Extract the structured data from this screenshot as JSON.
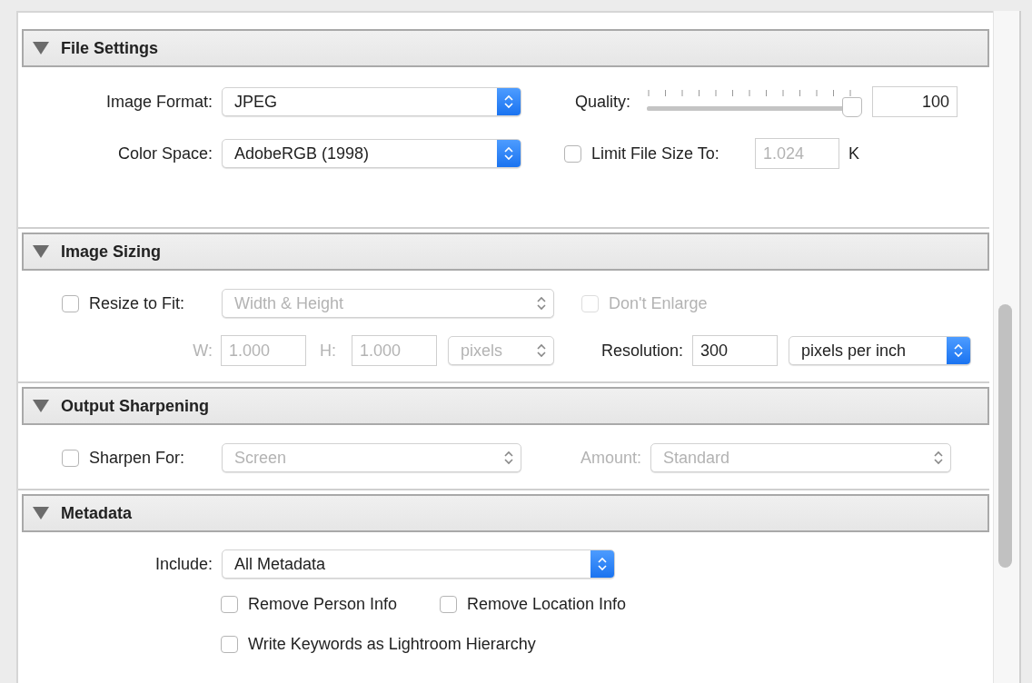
{
  "sections": [
    {
      "title": "File Settings",
      "expanded": true,
      "rows": [
        {
          "controls": [
            {
              "kind": "label",
              "text": "Image Format:",
              "disabled": false
            },
            {
              "kind": "select",
              "value": "JPEG",
              "disabled": false
            },
            {
              "kind": "label",
              "text": "Quality:",
              "disabled": false
            },
            {
              "kind": "slider",
              "level": 1
            },
            {
              "kind": "field",
              "value": "100",
              "disabled": false
            }
          ]
        },
        {
          "controls": [
            {
              "kind": "label",
              "text": "Color Space:",
              "disabled": false
            },
            {
              "kind": "select",
              "value": "AdobeRGB (1998)",
              "disabled": false
            },
            {
              "kind": "checkbox",
              "label": "Limit File Size To:",
              "checked": false,
              "disabled": false
            },
            {
              "kind": "field",
              "value": "1.024",
              "disabled": true
            },
            {
              "kind": "label",
              "text": "K",
              "disabled": false
            }
          ]
        }
      ]
    },
    {
      "title": "Image Sizing",
      "expanded": true,
      "rows": [
        {
          "controls": [
            {
              "kind": "checkbox",
              "label": "Resize to Fit:",
              "checked": false,
              "disabled": false
            },
            {
              "kind": "select",
              "value": "Width & Height",
              "disabled": true
            },
            {
              "kind": "checkbox",
              "label": "Don't Enlarge",
              "checked": false,
              "disabled": true
            }
          ]
        },
        {
          "controls": [
            {
              "kind": "label",
              "text": "W:",
              "disabled": true
            },
            {
              "kind": "field",
              "value": "1.000",
              "disabled": true
            },
            {
              "kind": "label",
              "text": "H:",
              "disabled": true
            },
            {
              "kind": "field",
              "value": "1.000",
              "disabled": true
            },
            {
              "kind": "select",
              "value": "pixels",
              "disabled": true
            },
            {
              "kind": "label",
              "text": "Resolution:",
              "disabled": false
            },
            {
              "kind": "field",
              "value": "300",
              "disabled": false
            },
            {
              "kind": "select",
              "value": "pixels per inch",
              "disabled": false
            }
          ]
        }
      ]
    },
    {
      "title": "Output Sharpening",
      "expanded": true,
      "rows": [
        {
          "controls": [
            {
              "kind": "checkbox",
              "label": "Sharpen For:",
              "checked": false,
              "disabled": false
            },
            {
              "kind": "select",
              "value": "Screen",
              "disabled": true
            },
            {
              "kind": "label",
              "text": "Amount:",
              "disabled": true
            },
            {
              "kind": "select",
              "value": "Standard",
              "disabled": true
            }
          ]
        }
      ]
    },
    {
      "title": "Metadata",
      "expanded": true,
      "rows": [
        {
          "controls": [
            {
              "kind": "label",
              "text": "Include:",
              "disabled": false
            },
            {
              "kind": "select",
              "value": "All Metadata",
              "disabled": false
            }
          ]
        },
        {
          "controls": [
            {
              "kind": "checkbox",
              "label": "Remove Person Info",
              "checked": false,
              "disabled": false
            },
            {
              "kind": "checkbox",
              "label": "Remove Location Info",
              "checked": false,
              "disabled": false
            }
          ]
        },
        {
          "controls": [
            {
              "kind": "checkbox",
              "label": "Write Keywords as Lightroom Hierarchy",
              "checked": false,
              "disabled": false
            }
          ]
        }
      ]
    }
  ]
}
